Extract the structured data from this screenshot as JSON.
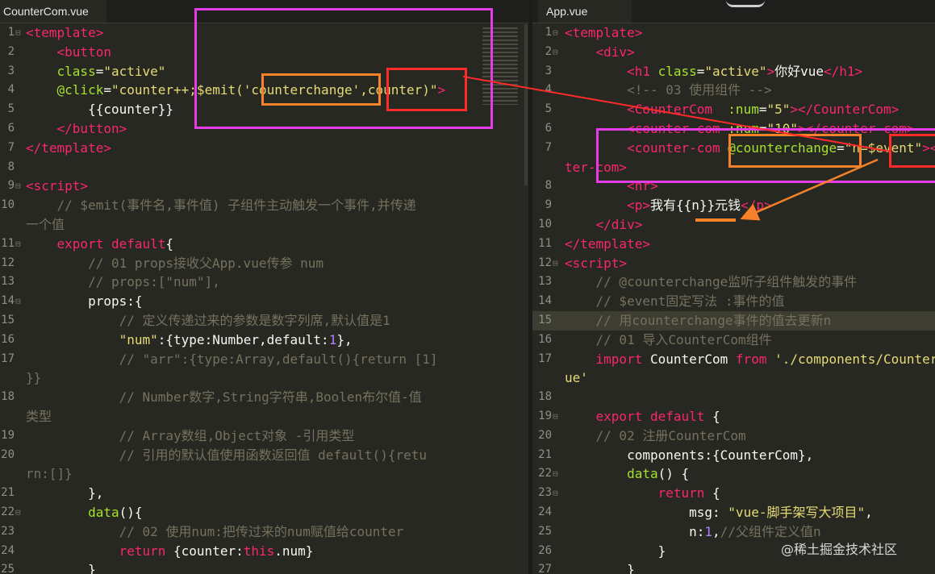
{
  "left": {
    "tab": "CounterCom.vue",
    "lines": [
      {
        "n": "1",
        "fold": "⊟",
        "segs": [
          [
            "tag",
            "<template>"
          ]
        ]
      },
      {
        "n": "2",
        "segs": [
          [
            "txt",
            "    "
          ],
          [
            "tag",
            "<button"
          ]
        ]
      },
      {
        "n": "3",
        "segs": [
          [
            "txt",
            "    "
          ],
          [
            "attr",
            "class"
          ],
          [
            "txt",
            "="
          ],
          [
            "str",
            "\"active\""
          ]
        ]
      },
      {
        "n": "4",
        "segs": [
          [
            "txt",
            "    "
          ],
          [
            "attr",
            "@click"
          ],
          [
            "txt",
            "="
          ],
          [
            "str",
            "\"counter++;$emit('counterchange',counter)\""
          ],
          [
            "tag",
            ">"
          ]
        ]
      },
      {
        "n": "5",
        "segs": [
          [
            "txt",
            "        {{counter}}"
          ]
        ]
      },
      {
        "n": "6",
        "segs": [
          [
            "txt",
            "    "
          ],
          [
            "tag",
            "</button>"
          ]
        ]
      },
      {
        "n": "7",
        "segs": [
          [
            "tag",
            "</template>"
          ]
        ]
      },
      {
        "n": "8",
        "segs": []
      },
      {
        "n": "9",
        "fold": "⊟",
        "segs": [
          [
            "tag",
            "<script>"
          ]
        ]
      },
      {
        "n": "10",
        "segs": [
          [
            "com",
            "    // $emit(事件名,事件值) 子组件主动触发一个事件,并传递"
          ]
        ]
      },
      {
        "n": "",
        "segs": [
          [
            "com",
            "一个值"
          ]
        ]
      },
      {
        "n": "11",
        "fold": "⊟",
        "segs": [
          [
            "txt",
            "    "
          ],
          [
            "kw",
            "export default"
          ],
          [
            "txt",
            "{"
          ]
        ]
      },
      {
        "n": "12",
        "segs": [
          [
            "com",
            "        // 01 props接收父App.vue传参 num"
          ]
        ]
      },
      {
        "n": "13",
        "segs": [
          [
            "com",
            "        // props:[\"num\"],"
          ]
        ]
      },
      {
        "n": "14",
        "fold": "⊟",
        "segs": [
          [
            "txt",
            "        props:{"
          ]
        ]
      },
      {
        "n": "15",
        "segs": [
          [
            "com",
            "            // 定义传递过来的参数是数字列席,默认值是1"
          ]
        ]
      },
      {
        "n": "16",
        "segs": [
          [
            "txt",
            "            "
          ],
          [
            "str",
            "\"num\""
          ],
          [
            "txt",
            ":{type:Number,default:"
          ],
          [
            "num",
            "1"
          ],
          [
            "txt",
            "},"
          ]
        ]
      },
      {
        "n": "17",
        "segs": [
          [
            "com",
            "            // \"arr\":{type:Array,default(){return [1]"
          ]
        ]
      },
      {
        "n": "",
        "segs": [
          [
            "com",
            "}}"
          ]
        ]
      },
      {
        "n": "18",
        "segs": [
          [
            "com",
            "            // Number数字,String字符串,Boolen布尔值-值"
          ]
        ]
      },
      {
        "n": "",
        "segs": [
          [
            "com",
            "类型"
          ]
        ]
      },
      {
        "n": "19",
        "segs": [
          [
            "com",
            "            // Array数组,Object对象 -引用类型"
          ]
        ]
      },
      {
        "n": "20",
        "segs": [
          [
            "com",
            "            // 引用的默认值使用函数返回值 default(){retu"
          ]
        ]
      },
      {
        "n": "",
        "segs": [
          [
            "com",
            "rn:[]}"
          ]
        ]
      },
      {
        "n": "21",
        "segs": [
          [
            "txt",
            "        },"
          ]
        ]
      },
      {
        "n": "22",
        "fold": "⊟",
        "segs": [
          [
            "txt",
            "        "
          ],
          [
            "attr",
            "data"
          ],
          [
            "txt",
            "(){"
          ]
        ]
      },
      {
        "n": "23",
        "segs": [
          [
            "com",
            "            // 02 使用num:把传过来的num赋值给counter"
          ]
        ]
      },
      {
        "n": "24",
        "segs": [
          [
            "txt",
            "            "
          ],
          [
            "kw",
            "return"
          ],
          [
            "txt",
            " {counter:"
          ],
          [
            "kw",
            "this"
          ],
          [
            "txt",
            ".num}"
          ]
        ]
      },
      {
        "n": "25",
        "segs": [
          [
            "txt",
            "        }"
          ]
        ]
      }
    ]
  },
  "right": {
    "tab": "App.vue",
    "lines": [
      {
        "n": "1",
        "fold": "⊟",
        "segs": [
          [
            "tag",
            "<template>"
          ]
        ]
      },
      {
        "n": "2",
        "fold": "⊟",
        "segs": [
          [
            "txt",
            "    "
          ],
          [
            "tag",
            "<div>"
          ]
        ]
      },
      {
        "n": "3",
        "segs": [
          [
            "txt",
            "        "
          ],
          [
            "tag",
            "<h1 "
          ],
          [
            "attr",
            "class"
          ],
          [
            "txt",
            "="
          ],
          [
            "str",
            "\"active\""
          ],
          [
            "tag",
            ">"
          ],
          [
            "txt",
            "你好vue"
          ],
          [
            "tag",
            "</h1>"
          ]
        ]
      },
      {
        "n": "4",
        "segs": [
          [
            "com",
            "        <!-- 03 使用组件 -->"
          ]
        ]
      },
      {
        "n": "5",
        "segs": [
          [
            "txt",
            "        "
          ],
          [
            "tag",
            "<CounterCom"
          ],
          [
            "txt",
            "  "
          ],
          [
            "attr",
            ":num"
          ],
          [
            "txt",
            "="
          ],
          [
            "str",
            "\"5\""
          ],
          [
            "tag",
            "></CounterCom>"
          ]
        ]
      },
      {
        "n": "6",
        "segs": [
          [
            "txt",
            "        "
          ],
          [
            "tag",
            "<counter-com"
          ],
          [
            "txt",
            " "
          ],
          [
            "attr",
            ":num"
          ],
          [
            "txt",
            "="
          ],
          [
            "str",
            "\"10\""
          ],
          [
            "tag",
            "></counter-com>"
          ]
        ]
      },
      {
        "n": "7",
        "segs": [
          [
            "txt",
            "        "
          ],
          [
            "tag",
            "<counter-com"
          ],
          [
            "txt",
            " "
          ],
          [
            "attr",
            "@counterchange"
          ],
          [
            "txt",
            "="
          ],
          [
            "str",
            "\"n=$event\""
          ],
          [
            "tag",
            "></coun"
          ]
        ]
      },
      {
        "n": "",
        "segs": [
          [
            "tag",
            "ter-com>"
          ]
        ]
      },
      {
        "n": "8",
        "segs": [
          [
            "txt",
            "        "
          ],
          [
            "tag",
            "<hr>"
          ]
        ]
      },
      {
        "n": "9",
        "segs": [
          [
            "txt",
            "        "
          ],
          [
            "tag",
            "<p>"
          ],
          [
            "txt",
            "我有{{n}}元钱"
          ],
          [
            "tag",
            "</p>"
          ]
        ]
      },
      {
        "n": "10",
        "segs": [
          [
            "txt",
            "    "
          ],
          [
            "tag",
            "</div>"
          ]
        ]
      },
      {
        "n": "11",
        "segs": [
          [
            "tag",
            "</template>"
          ]
        ]
      },
      {
        "n": "12",
        "fold": "⊟",
        "segs": [
          [
            "tag",
            "<script>"
          ]
        ]
      },
      {
        "n": "13",
        "segs": [
          [
            "com",
            "    // @counterchange监听子组件触发的事件"
          ]
        ]
      },
      {
        "n": "14",
        "segs": [
          [
            "com",
            "    // $event固定写法 :事件的值"
          ]
        ]
      },
      {
        "n": "15",
        "hl": true,
        "segs": [
          [
            "com",
            "    // 用counterchange事件的值去更新n"
          ]
        ]
      },
      {
        "n": "16",
        "segs": [
          [
            "com",
            "    // 01 导入CounterCom组件"
          ]
        ]
      },
      {
        "n": "17",
        "segs": [
          [
            "txt",
            "    "
          ],
          [
            "kw",
            "import"
          ],
          [
            "txt",
            " CounterCom "
          ],
          [
            "kw",
            "from"
          ],
          [
            "txt",
            " "
          ],
          [
            "str",
            "'./components/CounterCom.v"
          ]
        ]
      },
      {
        "n": "",
        "segs": [
          [
            "str",
            "ue'"
          ]
        ]
      },
      {
        "n": "18",
        "segs": []
      },
      {
        "n": "19",
        "fold": "⊟",
        "segs": [
          [
            "txt",
            "    "
          ],
          [
            "kw",
            "export default"
          ],
          [
            "txt",
            " {"
          ]
        ]
      },
      {
        "n": "20",
        "segs": [
          [
            "com",
            "    // 02 注册CounterCom"
          ]
        ]
      },
      {
        "n": "21",
        "segs": [
          [
            "txt",
            "        components:{CounterCom},"
          ]
        ]
      },
      {
        "n": "22",
        "fold": "⊟",
        "segs": [
          [
            "txt",
            "        "
          ],
          [
            "attr",
            "data"
          ],
          [
            "txt",
            "() {"
          ]
        ]
      },
      {
        "n": "23",
        "fold": "⊟",
        "segs": [
          [
            "txt",
            "            "
          ],
          [
            "kw",
            "return"
          ],
          [
            "txt",
            " {"
          ]
        ]
      },
      {
        "n": "24",
        "segs": [
          [
            "txt",
            "                msg: "
          ],
          [
            "str",
            "\"vue-脚手架写大项目\""
          ],
          [
            "txt",
            ","
          ]
        ]
      },
      {
        "n": "25",
        "segs": [
          [
            "txt",
            "                n:"
          ],
          [
            "num",
            "1"
          ],
          [
            "txt",
            ","
          ],
          [
            "com",
            "//父组件定义值n"
          ]
        ]
      },
      {
        "n": "26",
        "segs": [
          [
            "txt",
            "            }"
          ]
        ]
      },
      {
        "n": "27",
        "segs": [
          [
            "txt",
            "        }"
          ]
        ]
      }
    ]
  },
  "colors": {
    "magenta": "#e63ce6",
    "orange": "#f5822a",
    "red": "#ff2a2a",
    "bg": "#272822"
  },
  "watermark": "@稀土掘金技术社区"
}
